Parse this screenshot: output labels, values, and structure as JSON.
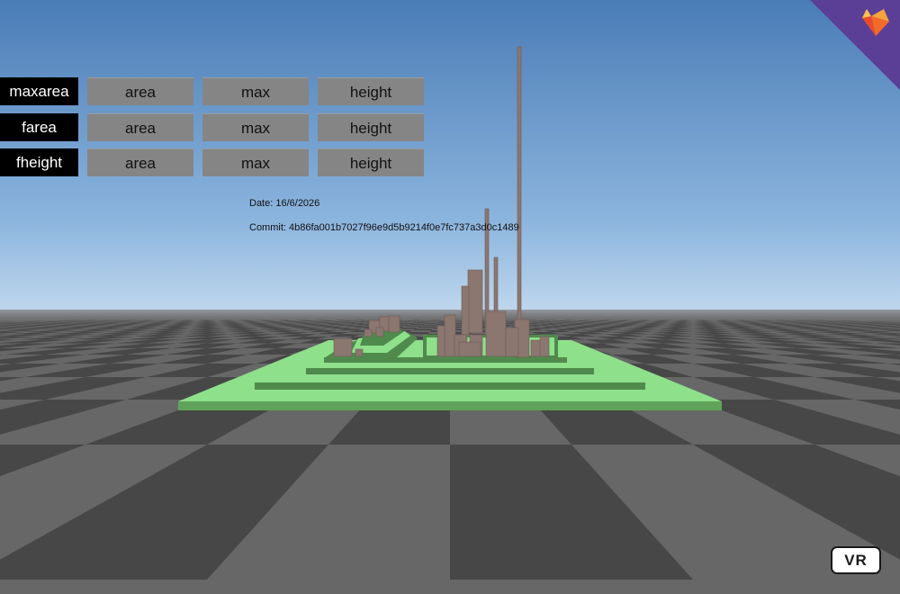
{
  "toolbar": {
    "rows": [
      {
        "metric": "maxarea",
        "buttons": [
          "area",
          "max",
          "height"
        ]
      },
      {
        "metric": "farea",
        "buttons": [
          "area",
          "max",
          "height"
        ]
      },
      {
        "metric": "fheight",
        "buttons": [
          "area",
          "max",
          "height"
        ]
      }
    ]
  },
  "info": {
    "date_label": "Date: 16/6/2026",
    "commit_label": "Commit: 4b86fa001b7027f96e9d5b9214f0e7fc737a3d0c1489"
  },
  "vr_button": {
    "label": "VR"
  },
  "corner_badge": {
    "icon": "fox-logo-icon",
    "color": "#5b3f96",
    "accent": "#f26b2b"
  },
  "colors": {
    "sky_top": "#4d80b8",
    "sky_bottom": "#a9c9e6",
    "ground_light": "#6b6b6b",
    "ground_dark": "#474747",
    "plate": "#8ee08a",
    "plate_dark": "#4f8a4c",
    "building": "#8b7670"
  }
}
